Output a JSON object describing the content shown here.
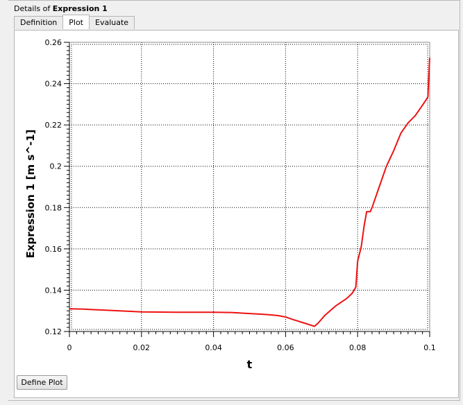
{
  "panel": {
    "title_prefix": "Details of ",
    "title_bold": "Expression 1"
  },
  "tabs": [
    {
      "label": "Definition",
      "active": false
    },
    {
      "label": "Plot",
      "active": true
    },
    {
      "label": "Evaluate",
      "active": false
    }
  ],
  "buttons": {
    "define_plot": "Define Plot"
  },
  "chart_data": {
    "type": "line",
    "xlabel": "t",
    "ylabel": "Expression 1 [m s^-1]",
    "xlim": [
      0,
      0.1
    ],
    "ylim": [
      0.12,
      0.26
    ],
    "x_ticks": [
      "0",
      "0.02",
      "0.04",
      "0.06",
      "0.08",
      "0.1"
    ],
    "y_ticks": [
      "0.12",
      "0.14",
      "0.16",
      "0.18",
      "0.2",
      "0.22",
      "0.24",
      "0.26"
    ],
    "grid": true,
    "line_color": "#ee1111",
    "series": [
      {
        "values": [
          [
            0.0,
            0.131
          ],
          [
            0.004,
            0.1308
          ],
          [
            0.01,
            0.1303
          ],
          [
            0.02,
            0.1295
          ],
          [
            0.03,
            0.1293
          ],
          [
            0.04,
            0.1293
          ],
          [
            0.045,
            0.1292
          ],
          [
            0.05,
            0.1287
          ],
          [
            0.055,
            0.1282
          ],
          [
            0.058,
            0.1277
          ],
          [
            0.06,
            0.127
          ],
          [
            0.062,
            0.1258
          ],
          [
            0.065,
            0.1242
          ],
          [
            0.068,
            0.1225
          ],
          [
            0.069,
            0.124
          ],
          [
            0.071,
            0.128
          ],
          [
            0.074,
            0.1325
          ],
          [
            0.077,
            0.136
          ],
          [
            0.0785,
            0.1385
          ],
          [
            0.0795,
            0.1415
          ],
          [
            0.08,
            0.154
          ],
          [
            0.081,
            0.161
          ],
          [
            0.0818,
            0.171
          ],
          [
            0.0825,
            0.178
          ],
          [
            0.0835,
            0.178
          ],
          [
            0.084,
            0.18
          ],
          [
            0.086,
            0.19
          ],
          [
            0.088,
            0.2
          ],
          [
            0.09,
            0.2075
          ],
          [
            0.092,
            0.216
          ],
          [
            0.094,
            0.221
          ],
          [
            0.096,
            0.2245
          ],
          [
            0.098,
            0.2295
          ],
          [
            0.0995,
            0.2335
          ],
          [
            0.1,
            0.2525
          ]
        ]
      }
    ]
  }
}
